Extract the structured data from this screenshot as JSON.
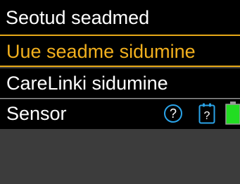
{
  "header": {
    "title": "Seotud seadmed"
  },
  "menu": {
    "items": [
      {
        "label": "Uue seadme sidumine",
        "selected": true
      },
      {
        "label": "CareLinki sidumine",
        "selected": false
      },
      {
        "label": "Sensor",
        "selected": false
      }
    ]
  },
  "status_icons": {
    "help_glyph": "?",
    "calibration_glyph": "?",
    "icons": [
      "help-icon",
      "calibration-icon",
      "battery-icon"
    ]
  },
  "colors": {
    "selection_accent": "#f2b01e",
    "help_icon_ring": "#2aa3e8",
    "battery_fill": "#22dd22",
    "background": "#000000"
  }
}
